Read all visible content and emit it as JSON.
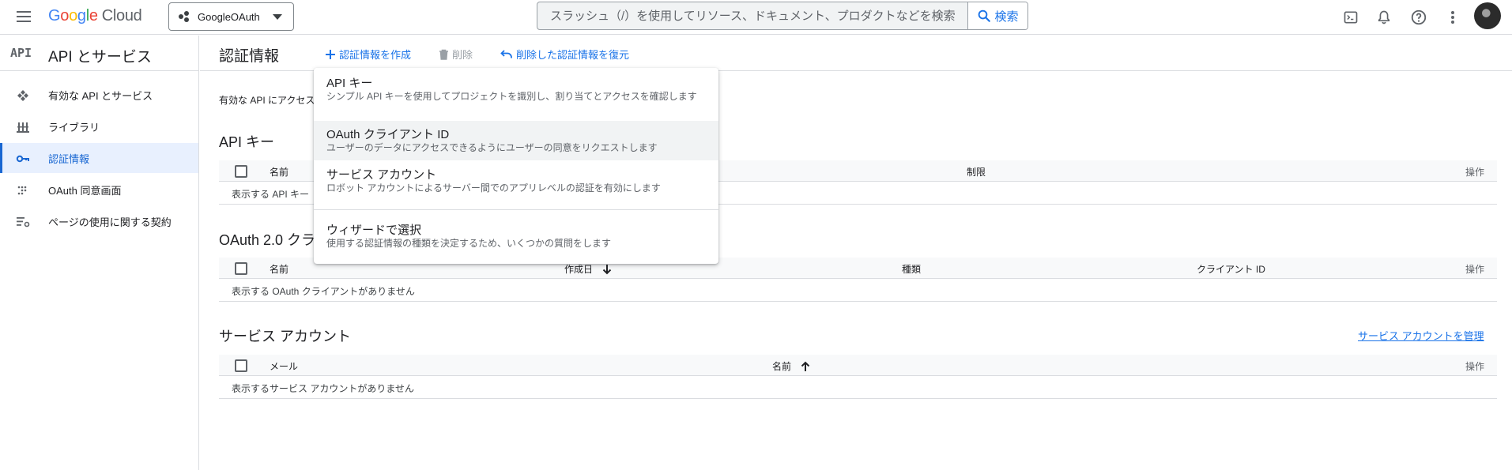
{
  "header": {
    "logo_parts": [
      "G",
      "o",
      "o",
      "g",
      "l",
      "e"
    ],
    "logo_cloud": "Cloud",
    "project": "GoogleOAuth",
    "search_placeholder": "スラッシュ（/）を使用してリソース、ドキュメント、プロダクトなどを検索",
    "search_button": "検索",
    "icons": [
      "menu-icon",
      "cloud-shell-icon",
      "bell-icon",
      "help-icon",
      "more-vert-icon"
    ]
  },
  "sidebar": {
    "badge": "API",
    "title": "API とサービス",
    "items": [
      {
        "label": "有効な API とサービス",
        "icon": "api-services-icon"
      },
      {
        "label": "ライブラリ",
        "icon": "library-icon"
      },
      {
        "label": "認証情報",
        "icon": "key-icon",
        "active": true
      },
      {
        "label": "OAuth 同意画面",
        "icon": "oauth-consent-icon"
      },
      {
        "label": "ページの使用に関する契約",
        "icon": "page-agreement-icon"
      }
    ]
  },
  "main": {
    "title": "認証情報",
    "actions": {
      "create": "認証情報を作成",
      "delete": "削除",
      "restore": "削除した認証情報を復元"
    },
    "intro": "有効な API にアクセス",
    "api_keys": {
      "title": "API キー",
      "columns": [
        "名前",
        "制限"
      ],
      "ops": "操作",
      "empty": "表示する API キー"
    },
    "oauth": {
      "title": "OAuth 2.0 クラ",
      "columns": [
        "名前",
        "作成日",
        "種類",
        "クライアント ID"
      ],
      "ops": "操作",
      "empty": "表示する OAuth クライアントがありません"
    },
    "service_accounts": {
      "title": "サービス アカウント",
      "manage_link": "サービス アカウントを管理",
      "columns": [
        "メール",
        "名前"
      ],
      "ops": "操作",
      "empty": "表示するサービス アカウントがありません"
    }
  },
  "dropdown": {
    "items": [
      {
        "title": "API キー",
        "desc": "シンプル API キーを使用してプロジェクトを識別し、割り当てとアクセスを確認します"
      },
      {
        "title": "OAuth クライアント ID",
        "desc": "ユーザーのデータにアクセスできるようにユーザーの同意をリクエストします",
        "highlighted": true
      },
      {
        "title": "サービス アカウント",
        "desc": "ロボット アカウントによるサーバー間でのアプリレベルの認証を有効にします"
      },
      {
        "title": "ウィザードで選択",
        "desc": "使用する認証情報の種類を決定するため、いくつかの質問をします"
      }
    ]
  },
  "colors": {
    "accent": "#1a73e8",
    "active_bg": "#e8f0fe",
    "border": "#dadce0"
  }
}
